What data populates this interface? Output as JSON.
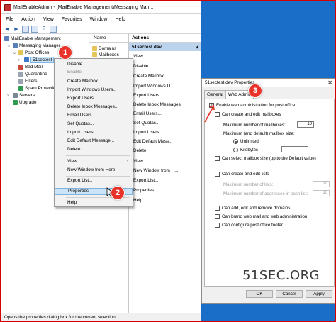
{
  "window": {
    "title": "MailEnableAdmin - [MailEnable Management\\Messaging Man...",
    "menu": [
      "File",
      "Action",
      "View",
      "Favorites",
      "Window",
      "Help"
    ]
  },
  "toolbar": {
    "icons": [
      "back-icon",
      "forward-icon",
      "folder-icon",
      "window-icon",
      "help-icon",
      "pane-icon"
    ]
  },
  "tree": {
    "root": "MailEnable Management",
    "messaging_manager": "Messaging Manager",
    "post_offices": "Post Offices",
    "selected_postoffice": "51sectest",
    "bad_mail": "Bad Mail",
    "quarantine": "Quarantine",
    "filters": "Filters",
    "spam": "Spam Protection",
    "servers": "Servers",
    "upgrade": "Upgrade"
  },
  "list": {
    "header": "Name",
    "items": [
      "Domains",
      "Mailboxes"
    ]
  },
  "actions_pane": {
    "header": "Actions",
    "subheader": "51sectest.dev",
    "items": [
      "View",
      "Disable",
      "Create Mailbox...",
      "Import Windows U...",
      "Export Users...",
      "Delete Inbox Messages",
      "Email Users...",
      "Set Quotas...",
      "Import Users...",
      "Edit Default Mess...",
      "Delete",
      "View",
      "New Window from H...",
      "Export List...",
      "Properties",
      "Help"
    ]
  },
  "context_menu": {
    "items": [
      {
        "label": "Disable",
        "disabled": false
      },
      {
        "label": "Enable",
        "disabled": true
      },
      {
        "label": "Create Mailbox...",
        "disabled": false
      },
      {
        "label": "Import Windows Users...",
        "disabled": false
      },
      {
        "label": "Export Users...",
        "disabled": false
      },
      {
        "label": "Delete Inbox Messages...",
        "disabled": false
      },
      {
        "label": "Email Users...",
        "disabled": false
      },
      {
        "label": "Set Quotas...",
        "disabled": false
      },
      {
        "label": "Import Users...",
        "disabled": false
      },
      {
        "label": "Edit Default Message...",
        "disabled": false
      },
      {
        "label": "Delete...",
        "disabled": false
      },
      {
        "label": "View",
        "disabled": false
      },
      {
        "label": "New Window from Here",
        "disabled": false
      },
      {
        "label": "Export List...",
        "disabled": false
      },
      {
        "label": "Properties",
        "disabled": false
      },
      {
        "label": "Help",
        "disabled": false
      }
    ]
  },
  "status_bar": "Opens the properties dialog box for the current selection.",
  "badges": {
    "one": "1",
    "two": "2",
    "three": "3"
  },
  "dialog": {
    "title": "51sectest.dev Properties",
    "close": "✕",
    "tabs": [
      "General",
      "Web Admin"
    ],
    "active_tab": "Web Admin",
    "enable_web_admin": "Enable web administration for post office",
    "enable_web_admin_checked": true,
    "create_edit_mailboxes": "Can create and edit mailboxes",
    "max_mailboxes_label": "Maximum number of mailboxes:",
    "max_mailboxes_value": "10",
    "max_default_size_label": "Maximum (and default) mailbox size:",
    "unlimited": "Unlimited",
    "kilobytes": "Kilobytes",
    "unlimited_selected": true,
    "select_mailbox_size": "Can select mailbox size (up to the Default value)",
    "create_edit_lists": "Can create and edit lists",
    "max_lists_label": "Maximum number of lists:",
    "max_lists_value": "10",
    "max_addresses_label": "Maximum number of addresses in each list:",
    "max_addresses_value": "10",
    "add_edit_remove_domains": "Can add, edit and remove domains",
    "brand_web_mail": "Can brand web mail and web administration",
    "configure_footer": "Can configure post office footer",
    "buttons": [
      "OK",
      "Cancel",
      "Apply"
    ]
  },
  "watermark": "51SEC.ORG",
  "colors": {
    "accent_red": "#e8342a",
    "frame": "#d40000",
    "desktop": "#1a6ec8",
    "selection": "#cce4f7"
  }
}
